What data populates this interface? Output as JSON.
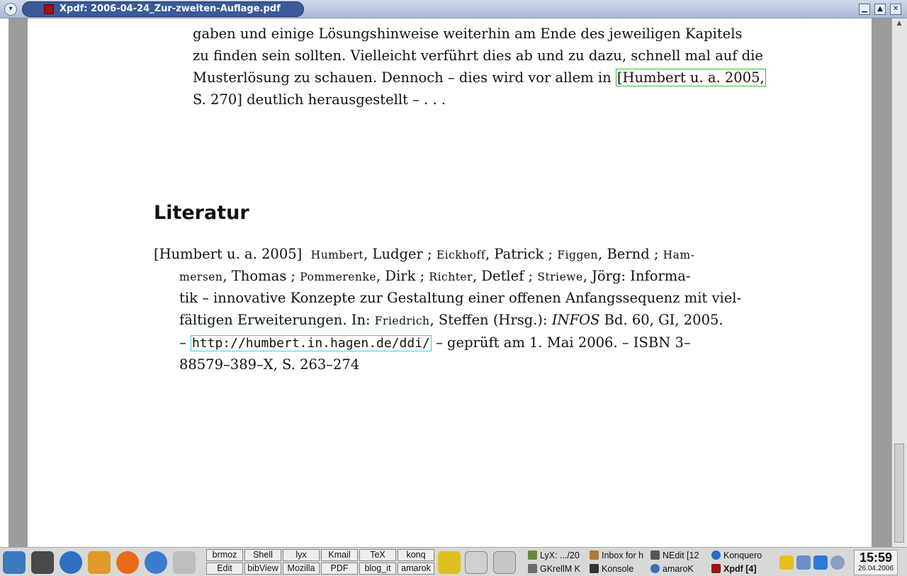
{
  "window": {
    "title": "Xpdf: 2006-04-24_Zur-zweiten-Auflage.pdf",
    "menu_glyph": "▾",
    "minimize_glyph": "▁",
    "maximize_glyph": "▲",
    "close_glyph": "✕"
  },
  "document": {
    "paragraph_lines": [
      "gaben und einige Lösungshinweise weiterhin am Ende des jeweiligen Kapitels",
      "zu finden sein sollten. Vielleicht verführt dies ab und zu dazu, schnell mal auf die",
      "Musterlösung zu schauen. Dennoch – dies wird vor allem in ",
      "S. 270] deutlich herausgestellt – . . ."
    ],
    "citation_link": "[Humbert u. a. 2005,",
    "heading": "Literatur",
    "reference": {
      "key": "[Humbert u. a. 2005]",
      "l1_a": "Humbert",
      "l1_b": ", Ludger ; ",
      "l1_c": "Eickhoff",
      "l1_d": ", Patrick ; ",
      "l1_e": "Figgen",
      "l1_f": ", Bernd ; ",
      "l1_g": "Ham-",
      "l2_a": "mersen",
      "l2_b": ", Thomas ; ",
      "l2_c": "Pommerenke",
      "l2_d": ", Dirk ; ",
      "l2_e": "Richter",
      "l2_f": ", Detlef ; ",
      "l2_g": "Striewe",
      "l2_h": ", Jörg: Informa-",
      "l3": "tik – innovative Konzepte zur Gestaltung einer offenen Anfangssequenz mit viel-",
      "l4_a": "fältigen Erweiterungen.   In: ",
      "l4_b": "Friedrich",
      "l4_c": ", Steffen (Hrsg.): ",
      "l4_d": "INFOS",
      "l4_e": " Bd. 60, GI, 2005.",
      "l5_a": "– ",
      "l5_url": "http://humbert.in.hagen.de/ddi/",
      "l5_b": " – geprüft am 1. Mai 2006. –  ISBN 3–",
      "l6": "88579–389–X, S. 263–274"
    }
  },
  "taskbar": {
    "pager": [
      "brmoz",
      "Shell",
      "lyx",
      "Kmail",
      "TeX",
      "konq",
      "Edit",
      "bibView",
      "Mozilla",
      "PDF",
      "blog_it",
      "amarok"
    ],
    "tasks": [
      {
        "label": "LyX: .../20",
        "color": "#6a8a3a"
      },
      {
        "label": "Inbox for h",
        "color": "#b07b3a"
      },
      {
        "label": "NEdit [12",
        "color": "#555555"
      },
      {
        "label": "Konquero",
        "color": "#2b6cc4"
      },
      {
        "label": "GKrellM K",
        "color": "#6b6b6b"
      },
      {
        "label": "Konsole",
        "color": "#333333"
      },
      {
        "label": "amaroK",
        "color": "#3d6db6"
      },
      {
        "label": "Xpdf [4]",
        "color": "#a31111"
      }
    ],
    "clock_time": "15:59",
    "clock_date": "26.04.2006"
  },
  "colors": {
    "gutter": "#9c9c9c",
    "citation_border": "#29c729",
    "url_border": "#33d6d6"
  }
}
